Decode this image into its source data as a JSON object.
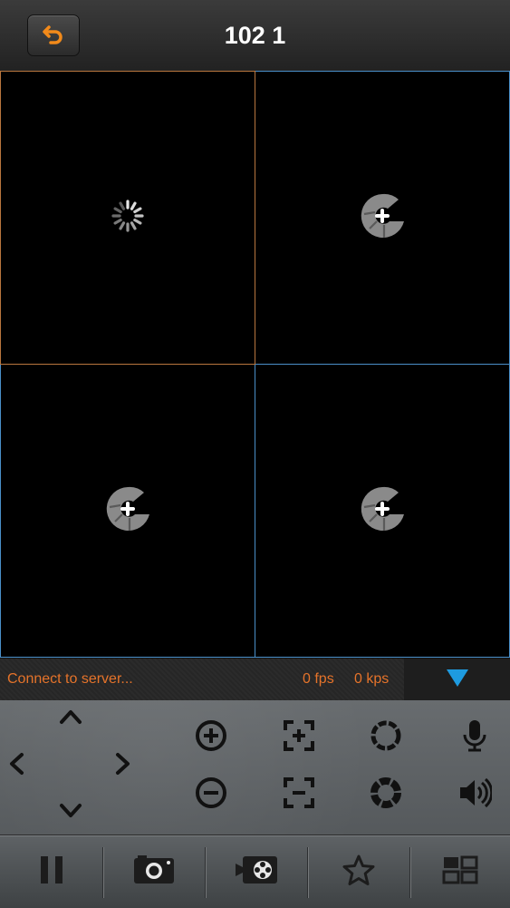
{
  "header": {
    "title": "102 1",
    "back_icon": "undo-arrow-icon"
  },
  "grid": {
    "cells": [
      {
        "state": "loading",
        "icon": "spinner-icon",
        "border": "#b8763e"
      },
      {
        "state": "empty",
        "icon": "add-camera-icon",
        "border": "#4a8fc9"
      },
      {
        "state": "empty",
        "icon": "add-camera-icon",
        "border": "#4a8fc9"
      },
      {
        "state": "empty",
        "icon": "add-camera-icon",
        "border": "#4a8fc9"
      }
    ]
  },
  "status": {
    "message": "Connect to server...",
    "fps": "0 fps",
    "kps": "0 kps",
    "dropdown_icon": "triangle-down-icon"
  },
  "controls": {
    "ptz": [
      "arrow-up-icon",
      "arrow-left-icon",
      "arrow-right-icon",
      "arrow-down-icon"
    ],
    "zoom_in_icon": "zoom-in-icon",
    "zoom_out_icon": "zoom-out-icon",
    "focus_in_icon": "focus-in-icon",
    "focus_out_icon": "focus-out-icon",
    "iris_open_icon": "iris-open-icon",
    "iris_close_icon": "iris-close-icon",
    "mic_icon": "microphone-icon",
    "speaker_icon": "speaker-icon"
  },
  "toolbar": {
    "items": [
      "pause-icon",
      "camera-snapshot-icon",
      "video-record-icon",
      "favorite-star-icon",
      "layout-icon"
    ]
  },
  "colors": {
    "accent_orange": "#e5732a",
    "selected_border": "#b8763e",
    "cell_border": "#4a8fc9",
    "dropdown_blue": "#1e9be0"
  }
}
